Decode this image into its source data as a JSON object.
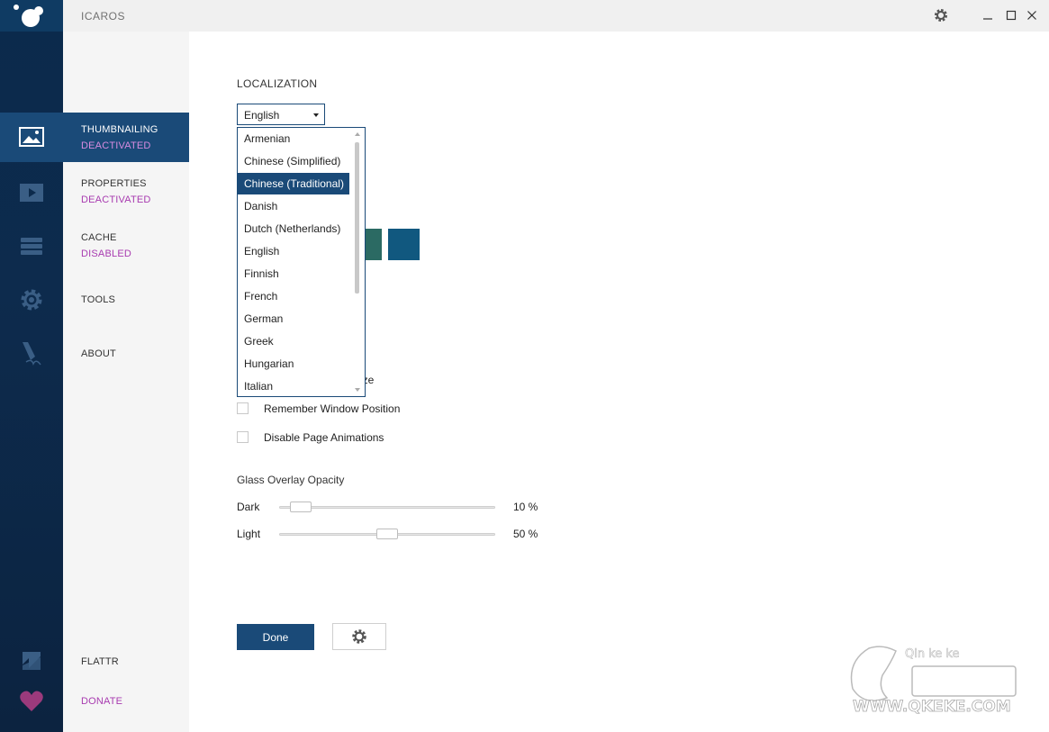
{
  "app": {
    "title": "ICAROS"
  },
  "nav": {
    "thumbnailing": {
      "label": "THUMBNAILING",
      "status": "DEACTIVATED"
    },
    "properties": {
      "label": "PROPERTIES",
      "status": "DEACTIVATED"
    },
    "cache": {
      "label": "CACHE",
      "status": "DISABLED"
    },
    "tools": {
      "label": "TOOLS"
    },
    "about": {
      "label": "ABOUT"
    },
    "flattr": {
      "label": "FLATTR"
    },
    "donate": {
      "label": "DONATE"
    }
  },
  "localization": {
    "title": "LOCALIZATION",
    "selected": "English",
    "options": [
      "Armenian",
      "Chinese (Simplified)",
      "Chinese (Traditional)",
      "Danish",
      "Dutch (Netherlands)",
      "English",
      "Finnish",
      "French",
      "German",
      "Greek",
      "Hungarian",
      "Italian"
    ],
    "highlighted": "Chinese (Traditional)"
  },
  "partial_label": "ize",
  "swatches": [
    "#2b6a63",
    "#11587f"
  ],
  "checkboxes": [
    {
      "label": "Remember Window Position",
      "checked": false
    },
    {
      "label": "Disable Page Animations",
      "checked": false
    }
  ],
  "opacity": {
    "title": "Glass Overlay Opacity",
    "dark": {
      "label": "Dark",
      "value": "10 %",
      "level": 0.1
    },
    "light": {
      "label": "Light",
      "value": "50 %",
      "level": 0.5
    }
  },
  "buttons": {
    "done": "Done"
  },
  "watermark": {
    "domain": "WWW.QKEKE.COM",
    "pinyin": "Qin ke ke"
  },
  "colors": {
    "accent": "#1a4a78",
    "rail": "#0b2a4c",
    "status": "#a83bb0"
  }
}
